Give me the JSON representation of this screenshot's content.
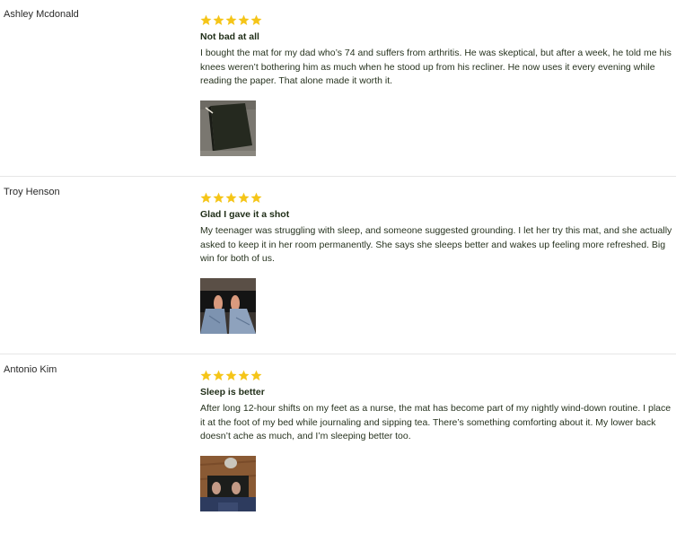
{
  "reviews": [
    {
      "author": "Ashley Mcdonald",
      "rating": 5,
      "title": "Not bad at all",
      "text": "I bought the mat for my dad who’s 74 and suffers from arthritis. He was skeptical, but after a week, he told me his knees weren’t bothering him as much when he stood up from his recliner. He now uses it every evening while reading the paper. That alone made it worth it."
    },
    {
      "author": "Troy Henson",
      "rating": 5,
      "title": "Glad I gave it a shot",
      "text": "My teenager was struggling with sleep, and someone suggested grounding. I let her try this mat, and she actually asked to keep it in her room permanently. She says she sleeps better and wakes up feeling more refreshed. Big win for both of us."
    },
    {
      "author": "Antonio Kim",
      "rating": 5,
      "title": "Sleep is better",
      "text": "After long 12-hour shifts on my feet as a nurse, the mat has become part of my nightly wind-down routine. I place it at the foot of my bed while journaling and sipping tea. There’s something comforting about it. My lower back doesn’t ache as much, and I’m sleeping better too."
    }
  ],
  "colors": {
    "star": "#f5c518",
    "divider": "#e6e6e6",
    "text": "#27331f"
  },
  "icons": {
    "star": "star-icon"
  }
}
